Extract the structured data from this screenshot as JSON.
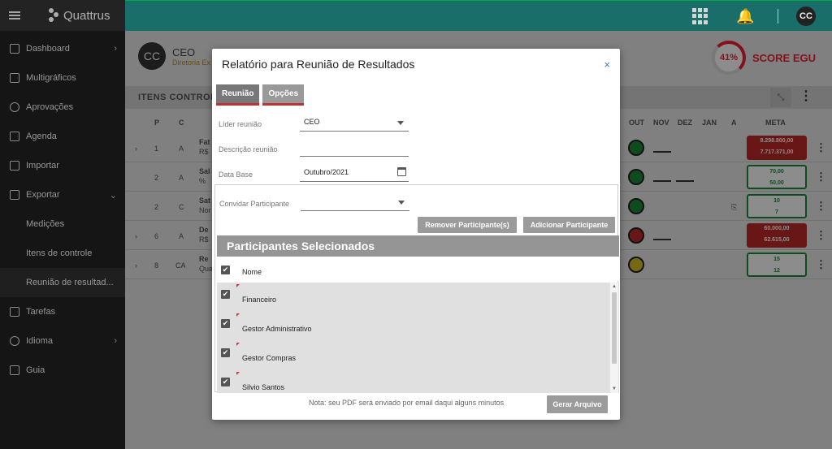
{
  "app": {
    "name": "Quattrus"
  },
  "colors": {
    "topbar": "#1a6e6a",
    "sidebar": "#1c1c1c",
    "score_red": "#e23333",
    "link_blue": "#2a7fe0"
  },
  "sidebar": {
    "items": [
      {
        "label": "Dashboard",
        "icon": "dashboard-icon",
        "chevron": "›"
      },
      {
        "label": "Multigráficos",
        "icon": "chart-icon"
      },
      {
        "label": "Aprovações",
        "icon": "approval-icon"
      },
      {
        "label": "Agenda",
        "icon": "calendar-icon"
      },
      {
        "label": "Importar",
        "icon": "import-icon"
      },
      {
        "label": "Exportar",
        "icon": "export-icon",
        "chevron": "⌄"
      },
      {
        "label": "Medições"
      },
      {
        "label": "Itens de controle"
      },
      {
        "label": "Reunião de resultad..."
      },
      {
        "label": "Tarefas",
        "icon": "layers-icon"
      },
      {
        "label": "Idioma",
        "icon": "globe-icon",
        "chevron": "›"
      },
      {
        "label": "Guia",
        "icon": "guide-icon"
      }
    ]
  },
  "topbar": {
    "avatar": "CC"
  },
  "background": {
    "user": {
      "initials": "CC",
      "name": "CEO",
      "role": "Diretoria Ex"
    },
    "score": {
      "value": "41%",
      "label": "SCORE EGU"
    },
    "table_title": "ITENS CONTROL",
    "columns": {
      "p": "P",
      "c": "C",
      "out": "OUT",
      "nov": "NOV",
      "dez": "DEZ",
      "jan": "JAN",
      "a": "A",
      "meta": "META"
    },
    "rows": [
      {
        "p": "1",
        "c": "A",
        "name": "Fat",
        "unit": "R$",
        "meta": [
          "8.298.800,00",
          "7.717.371,00"
        ]
      },
      {
        "p": "2",
        "c": "A",
        "name": "Sal",
        "unit": "%",
        "meta": [
          "70,00",
          "50,00"
        ]
      },
      {
        "p": "2",
        "c": "C",
        "name": "Sat",
        "unit": "Nor",
        "meta": [
          "10",
          "7"
        ]
      },
      {
        "p": "6",
        "c": "A",
        "name": "De",
        "unit": "R$",
        "meta": [
          "60.000,00",
          "62.615,00"
        ]
      },
      {
        "p": "8",
        "c": "CA",
        "name": "Re",
        "unit": "Qua",
        "meta": [
          "15",
          "12"
        ]
      }
    ]
  },
  "modal": {
    "title": "Relatório para Reunião de Resultados",
    "close": "×",
    "tabs": [
      "Reunião",
      "Opções"
    ],
    "fields": {
      "lider_label": "Líder reunião",
      "lider_value": "CEO",
      "descricao_label": "Descrição reunião",
      "descricao_value": "",
      "data_label": "Data Base",
      "data_value": "Outubro/2021",
      "convidar_label": "Convidar Participante",
      "convidar_value": ""
    },
    "buttons": {
      "remover": "Remover Participante(s)",
      "adicionar": "Adicionar Participante",
      "gerar": "Gerar Arquivo"
    },
    "participants_title": "Participantes Selecionados",
    "list_header": "Nome",
    "participants": [
      "Financeiro",
      "Gestor Administrativo",
      "Gestor Compras",
      "Silvio Santos"
    ],
    "note": "Nota: seu PDF será enviado por email daqui alguns minutos"
  }
}
